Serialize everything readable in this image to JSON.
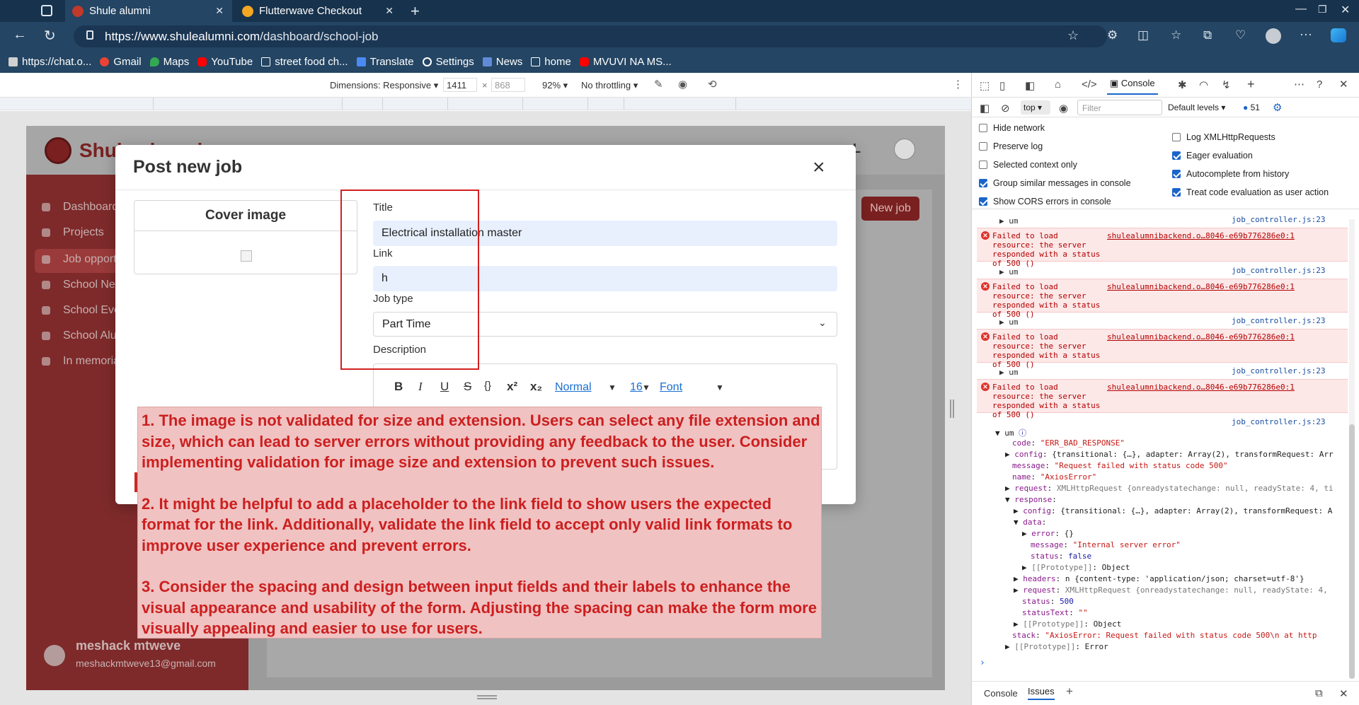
{
  "browser": {
    "tabs": [
      {
        "title": "Shule alumni",
        "favicon": "shule-favicon-icon"
      },
      {
        "title": "Flutterwave Checkout",
        "favicon": "flutterwave-favicon-icon"
      }
    ],
    "url_host": "https://www.shulealumni.com",
    "url_path": "/dashboard/school-job",
    "bookmarks": [
      "https://chat.o...",
      "Gmail",
      "Maps",
      "YouTube",
      "street food ch...",
      "Translate",
      "Settings",
      "News",
      "home",
      "MVUVI NA MS..."
    ]
  },
  "device_toolbar": {
    "dimensions_label": "Dimensions: Responsive",
    "width": "1411",
    "times": "×",
    "height_placeholder": "868",
    "zoom": "92%",
    "throttle": "No throttling"
  },
  "app": {
    "logo_text": "Shule alumni",
    "sidebar": [
      "Dashboard",
      "Projects",
      "Job opportunities",
      "School News",
      "School Events",
      "School Alumni",
      "In memorial"
    ],
    "new_job_button": "New job",
    "header_letter": "L",
    "user_name": "meshack mtweve",
    "user_email": "meshackmtweve13@gmail.com"
  },
  "modal": {
    "title": "Post new job",
    "close_glyph": "×",
    "cover_image_label": "Cover image",
    "title_label": "Title",
    "title_value": "Electrical installation master",
    "link_label": "Link",
    "link_value": "h",
    "job_type_label": "Job type",
    "job_type_value": "Part Time",
    "description_label": "Description",
    "editor_toolbar": {
      "bold": "B",
      "italic": "I",
      "underline": "U",
      "strike": "S",
      "code": "{}",
      "superscript": "x²",
      "subscript": "x₂",
      "header_select": "Normal",
      "size_select": "16",
      "font_select": "Font"
    }
  },
  "annotation": [
    "1. The image is not validated for size and extension. Users can select any file extension and size, which can lead to server errors without providing any feedback to the user. Consider implementing validation for image size and extension to prevent such issues.",
    "2. It might be helpful to add a placeholder to the link field to show users the expected format for the link. Additionally, validate the link field to accept only valid link formats to improve user experience and prevent errors.",
    "3. Consider the spacing and design between input fields and their labels to enhance the visual appearance and usability of the form. Adjusting the spacing can make the form more visually appealing and easier to use for users."
  ],
  "devtools": {
    "active_tab": "Console",
    "context": "top",
    "filter_placeholder": "Filter",
    "levels": "Default levels",
    "issues_count": "51",
    "settings_left": [
      {
        "label": "Hide network",
        "checked": false
      },
      {
        "label": "Preserve log",
        "checked": false
      },
      {
        "label": "Selected context only",
        "checked": false
      },
      {
        "label": "Group similar messages in console",
        "checked": true
      },
      {
        "label": "Show CORS errors in console",
        "checked": true
      }
    ],
    "settings_right": [
      {
        "label": "Log XMLHttpRequests",
        "checked": false
      },
      {
        "label": "Eager evaluation",
        "checked": true
      },
      {
        "label": "Autocomplete from history",
        "checked": true
      },
      {
        "label": "Treat code evaluation as user action",
        "checked": true
      }
    ],
    "log_source": "job_controller.js:23",
    "um": "um",
    "error_message_1": "Failed to load",
    "error_message_2": "resource: the server",
    "error_message_3": "responded with a status of 500 ()",
    "error_link": "shulealumnibackend.o…8046-e69b776286e0:1",
    "expanded": {
      "code": "\"ERR_BAD_RESPONSE\"",
      "config": "{transitional: {…}, adapter: Array(2), transformRequest: Arr",
      "message": "\"Request failed with status code 500\"",
      "name": "\"AxiosError\"",
      "request": "XMLHttpRequest {onreadystatechange: null, readyState: 4, ti",
      "response_config": "{transitional: {…}, adapter: Array(2), transformRequest: A",
      "data_error": "{}",
      "data_message": "\"Internal server error\"",
      "data_status": "false",
      "proto_object": "Object",
      "headers": "n {content-type: 'application/json; charset=utf-8'}",
      "response_request": "XMLHttpRequest {onreadystatechange: null, readyState: 4,",
      "status": "500",
      "statusText": "\"\"",
      "stack": "\"AxiosError: Request failed with status code 500\\n    at http",
      "proto_error": "Error"
    },
    "bottom_tabs": [
      "Console",
      "Issues"
    ]
  }
}
